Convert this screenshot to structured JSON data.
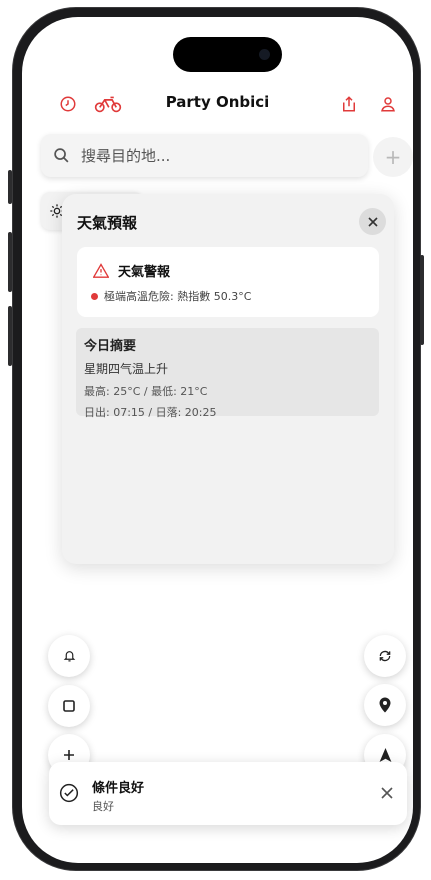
{
  "app": {
    "title": "Party Onbici"
  },
  "header": {
    "history_icon": "clock-icon",
    "bike_icon": "bike-icon",
    "share_icon": "share-icon",
    "profile_icon": "user-icon"
  },
  "search": {
    "placeholder": "搜尋目的地..."
  },
  "weather": {
    "title": "天氣預報",
    "alert": {
      "title": "天氣警報",
      "item": "極端高溫危險: 熱指數 50.3°C"
    },
    "summary": {
      "title": "今日摘要",
      "description": "星期四气温上升",
      "temps": "最高: 25°C / 最低: 21°C",
      "sun": "日出: 07:15 / 日落: 20:25"
    }
  },
  "toast": {
    "title": "條件良好",
    "subtitle": "良好"
  },
  "colors": {
    "accent": "#e03a3a",
    "panel": "#f2f2f2"
  }
}
